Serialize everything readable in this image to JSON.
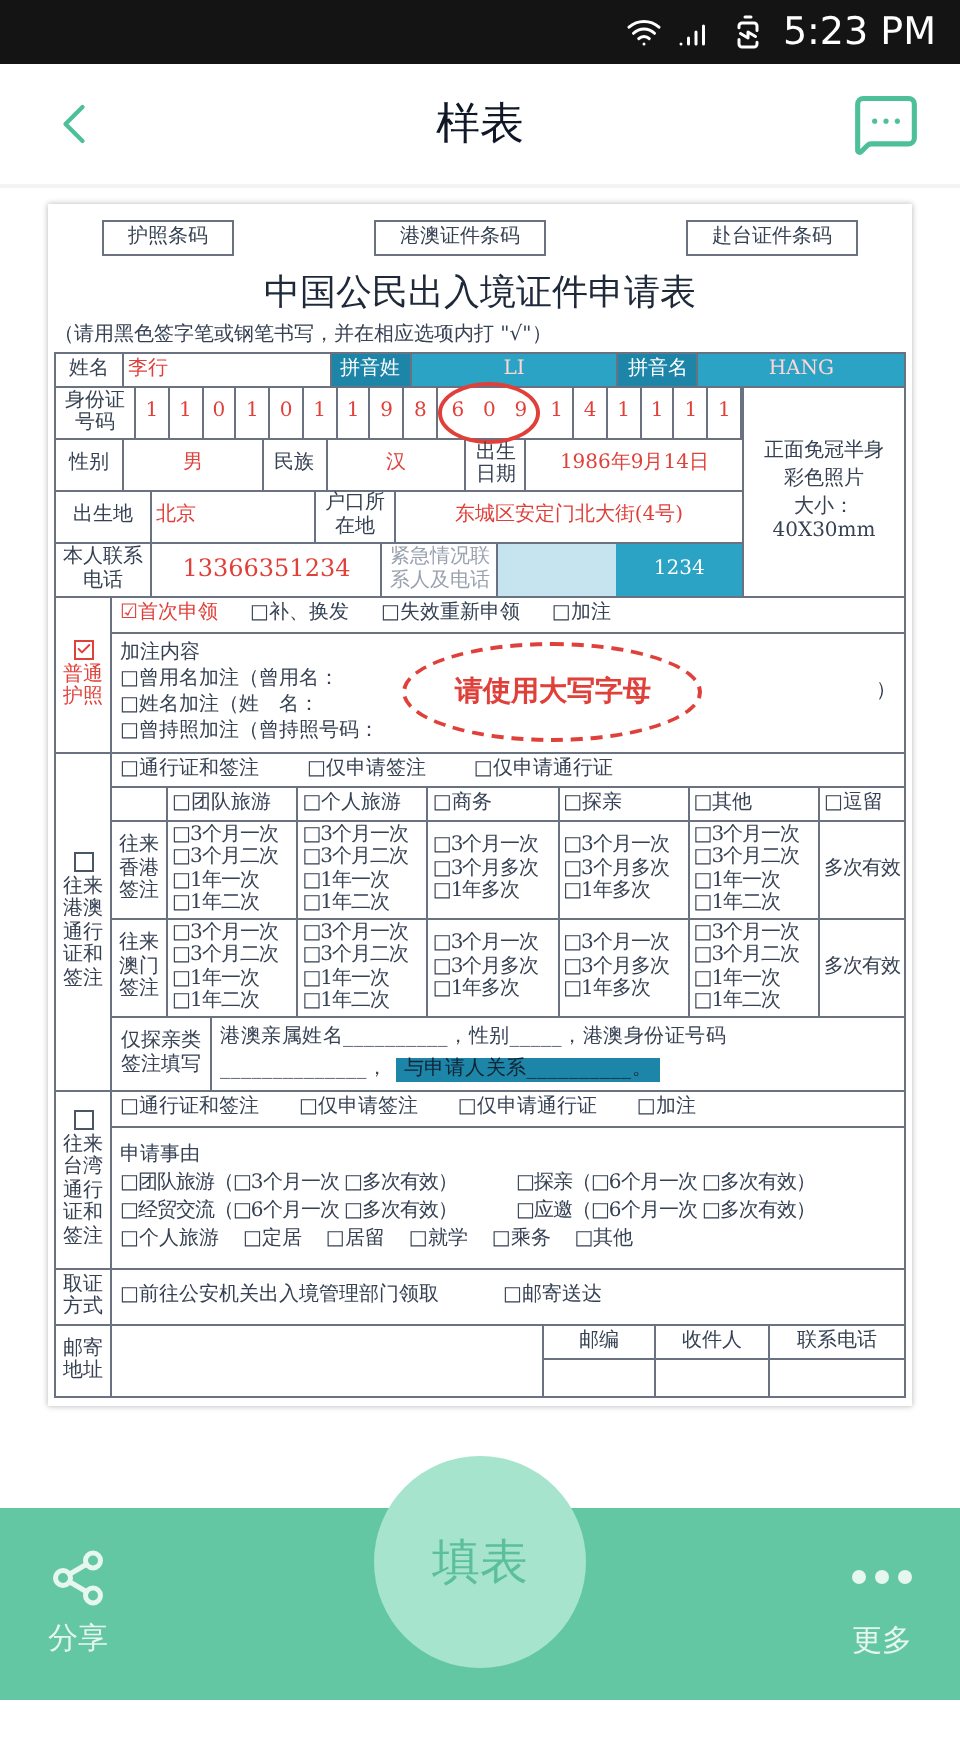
{
  "status_bar": {
    "time": "5:23 PM"
  },
  "header": {
    "title": "样表"
  },
  "form": {
    "barcode_fields": [
      "护照条码",
      "港澳证件条码",
      "赴台证件条码"
    ],
    "title": "中国公民出入境证件申请表",
    "instruction": "（请用黑色签字笔或钢笔书写，并在相应选项内打 \"√\"）",
    "name": {
      "label": "姓名",
      "value": "李行",
      "surname_label": "拼音姓",
      "surname": "LI",
      "given_label": "拼音名",
      "given": "HANG"
    },
    "id_number": {
      "label": "身份证号码",
      "digits": [
        {
          "text": "1",
          "circled": false
        },
        {
          "text": "1",
          "circled": false
        },
        {
          "text": "0",
          "circled": false
        },
        {
          "text": "1",
          "circled": false
        },
        {
          "text": "0",
          "circled": false
        },
        {
          "text": "1",
          "circled": false
        },
        {
          "text": "1",
          "circled": false
        },
        {
          "text": "9",
          "circled": false
        },
        {
          "text": "8",
          "circled": false
        },
        {
          "text": "6",
          "circled": true
        },
        {
          "text": "0",
          "circled": true
        },
        {
          "text": "9",
          "circled": true
        },
        {
          "text": "1",
          "circled": false
        },
        {
          "text": "4",
          "circled": false
        },
        {
          "text": "1",
          "circled": false
        },
        {
          "text": "1",
          "circled": false
        },
        {
          "text": "1",
          "circled": false
        },
        {
          "text": "1",
          "circled": false
        }
      ]
    },
    "photo": [
      "正面免冠半身",
      "彩色照片",
      "大小：40X30mm"
    ],
    "sex": {
      "label": "性别",
      "value": "男"
    },
    "ethnicity": {
      "label": "民族",
      "value": "汉"
    },
    "birth_date": {
      "label": "出生日期",
      "value": "1986年9月14日"
    },
    "birthplace": {
      "label": "出生地",
      "value": "北京"
    },
    "residence": {
      "label": "户口所在地",
      "value": "东城区安定门北大街(4号)"
    },
    "phone": {
      "label": "本人联系电话",
      "value": "13366351234"
    },
    "emergency": {
      "label": "紧急情况联系人及电话",
      "value": "1234"
    },
    "passport": {
      "checked": true,
      "label": "普通护照",
      "filled": true,
      "types": [
        {
          "text": "☑首次申领",
          "filled": true
        },
        {
          "text": "□补、换发",
          "filled": false
        },
        {
          "text": "□失效重新申领",
          "filled": false
        },
        {
          "text": "□加注",
          "filled": false
        }
      ],
      "annotation_title": "加注内容",
      "annotations": [
        "□曾用名加注（曾用名：",
        "□姓名加注（姓　名：",
        "□曾持照加注（曾持照号码："
      ],
      "closing": "）",
      "hint": "请使用大写字母"
    },
    "hk_macao": {
      "checked": false,
      "label": "往来港澳通行证和签注",
      "types": [
        "□通行证和签注",
        "□仅申请签注",
        "□仅申请通行证"
      ],
      "purposes": [
        "□团队旅游",
        "□个人旅游",
        "□商务",
        "□探亲",
        "□其他",
        "□逗留"
      ],
      "endorsements": [
        {
          "label": "往来香港签注",
          "cells": [
            [
              "□3个月一次",
              "□3个月二次",
              "□1年一次",
              "□1年二次"
            ],
            [
              "□3个月一次",
              "□3个月二次",
              "□1年一次",
              "□1年二次"
            ],
            [
              "□3个月一次",
              "□3个月多次",
              "□1年多次"
            ],
            [
              "□3个月一次",
              "□3个月多次",
              "□1年多次"
            ],
            [
              "□3个月一次",
              "□3个月二次",
              "□1年一次",
              "□1年二次"
            ],
            [
              "多次有效"
            ]
          ]
        },
        {
          "label": "往来澳门签注",
          "cells": [
            [
              "□3个月一次",
              "□3个月二次",
              "□1年一次",
              "□1年二次"
            ],
            [
              "□3个月一次",
              "□3个月二次",
              "□1年一次",
              "□1年二次"
            ],
            [
              "□3个月一次",
              "□3个月多次",
              "□1年多次"
            ],
            [
              "□3个月一次",
              "□3个月多次",
              "□1年多次"
            ],
            [
              "□3个月一次",
              "□3个月二次",
              "□1年一次",
              "□1年二次"
            ],
            [
              "多次有效"
            ]
          ]
        }
      ],
      "relatives": {
        "label": "仅探亲类签注填写",
        "line1": "港澳亲属姓名__________，性别_____，港澳身份证号码",
        "line2": "______________，",
        "relation": "与申请人关系__________。"
      }
    },
    "taiwan": {
      "checked": false,
      "label": "往来台湾通行证和签注",
      "types": [
        "□通行证和签注",
        "□仅申请签注",
        "□仅申请通行证",
        "□加注"
      ],
      "reason_title": "申请事由",
      "reason_pairs": [
        "□团队旅游（□3个月一次 □多次有效）",
        "□探亲（□6个月一次 □多次有效）",
        "□经贸交流（□6个月一次 □多次有效）",
        "□应邀（□6个月一次 □多次有效）"
      ],
      "reason_options": [
        "□个人旅游",
        "□定居",
        "□居留",
        "□就学",
        "□乘务",
        "□其他"
      ]
    },
    "collection": {
      "label": "取证方式",
      "options": [
        "□前往公安机关出入境管理部门领取",
        "□邮寄送达"
      ]
    },
    "mailing": {
      "label": "邮寄地址",
      "columns": [
        "邮编",
        "收件人",
        "联系电话"
      ]
    }
  },
  "bottom_bar": {
    "share": "分享",
    "fill": "填表",
    "more": "更多"
  }
}
